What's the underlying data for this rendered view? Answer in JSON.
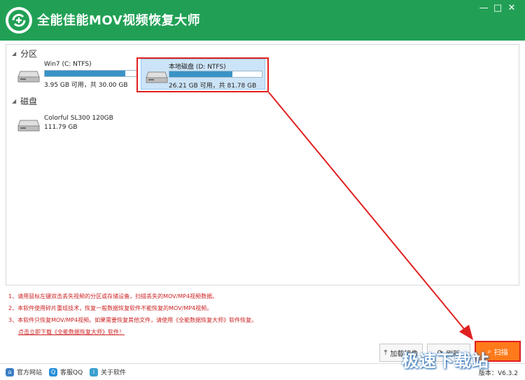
{
  "app": {
    "title": "全能佳能MOV视频恢复大师",
    "min_glyph": "—",
    "max_glyph": "□",
    "close_glyph": "✕"
  },
  "sections": {
    "partition_label": "分区",
    "disk_label": "磁盘"
  },
  "partitions": [
    {
      "name": "Win7 (C: NTFS)",
      "info": "3.95 GB 可用，共 30.00 GB",
      "used_fraction": 0.87,
      "selected": false
    },
    {
      "name": "本地磁盘 (D: NTFS)",
      "info": "26.21 GB 可用，共 81.78 GB",
      "used_fraction": 0.68,
      "selected": true
    }
  ],
  "disks": [
    {
      "name": "Colorful SL300 120GB",
      "info": "111.79 GB"
    }
  ],
  "notes": {
    "line1": "1、请用鼠标左键双击丢失视频的分区或存储设备，扫描丢失的MOV/MP4视频数据。",
    "line2": "2、本软件使用碎片重组技术，恢复一般数据恢复软件不能恢复的MOV/MP4视频。",
    "line3": "3、本软件只恢复MOV/MP4视频。如果需要恢复其他文件，请使用《全能数据恢复大师》软件恢复。",
    "link": "点击立即下载《全能数据恢复大师》软件！"
  },
  "buttons": {
    "load_label": "加载镜像",
    "refresh_label": "刷新",
    "scan_label": "扫描"
  },
  "statusbar": {
    "website": "官方网站",
    "qq": "客服QQ",
    "about": "关于软件",
    "version_label": "版本：",
    "version": "V6.3.2"
  },
  "watermark": "极速下载站",
  "colors": {
    "titlebar": "#21a055",
    "accent": "#ff7a1a",
    "annotation": "#e02020",
    "bar_fill": "#3a93c6"
  }
}
